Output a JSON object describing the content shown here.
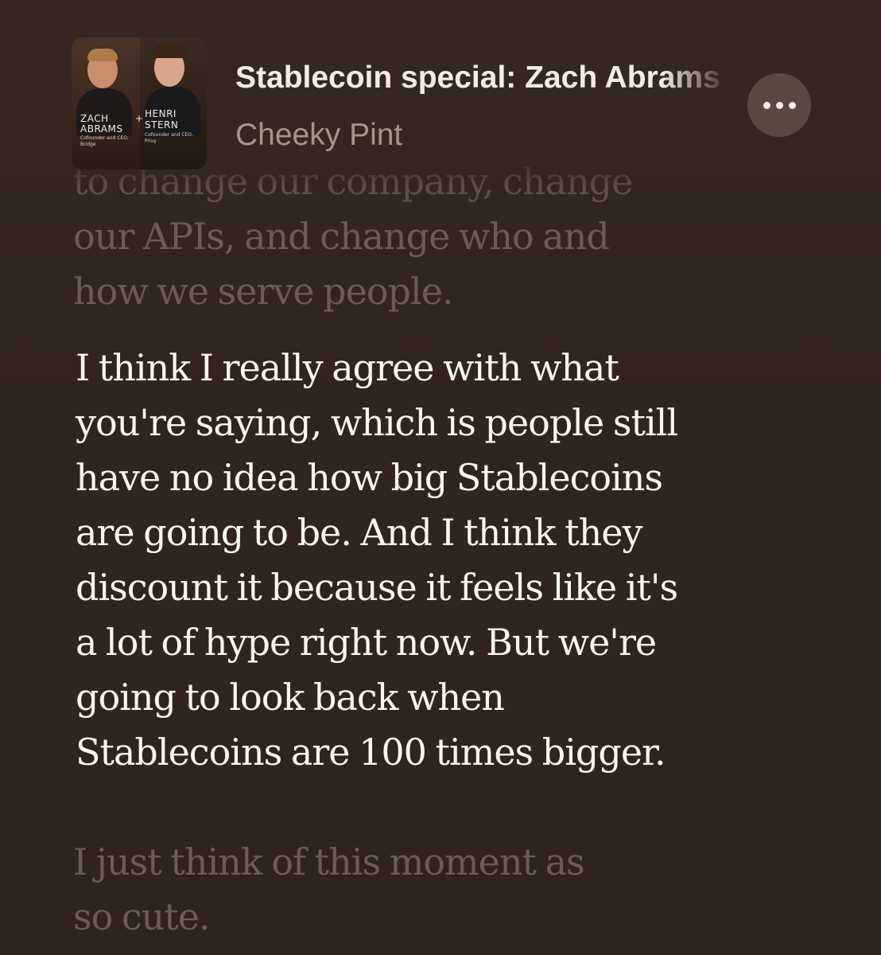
{
  "header": {
    "artwork": {
      "left_name_line1": "ZACH",
      "left_name_line2": "ABRAMS",
      "left_role_line1": "Cofounder and CEO,",
      "left_role_line2": "Bridge",
      "plus": "+",
      "right_name_line1": "HENRI",
      "right_name_line2": "STERN",
      "right_role_line1": "Cofounder and CEO,",
      "right_role_line2": "Privy"
    },
    "episode_title": "Stablecoin special: Zach Abrams",
    "show_name": "Cheeky Pint",
    "more_icon": "ellipsis-icon"
  },
  "transcript": {
    "previous": {
      "lines": [
        "to change our company, change",
        "our APIs, and change who and",
        "how we serve people."
      ]
    },
    "current": {
      "lines": [
        "I think I really agree with what",
        "you're saying, which is people still",
        "have no idea how big Stablecoins",
        "are going to be. And I think they",
        "discount it because it feels like it's",
        "a lot of hype right now. But we're",
        "going to look back when",
        "Stablecoins are 100 times bigger."
      ]
    },
    "next": {
      "lines": [
        "I just think of this moment as",
        "so cute."
      ]
    }
  },
  "colors": {
    "background": "#33261f",
    "current_text": "#fbf5ef",
    "inactive_text": "#6d5b50",
    "subtitle": "#a89486",
    "button_bg": "#59483e"
  }
}
